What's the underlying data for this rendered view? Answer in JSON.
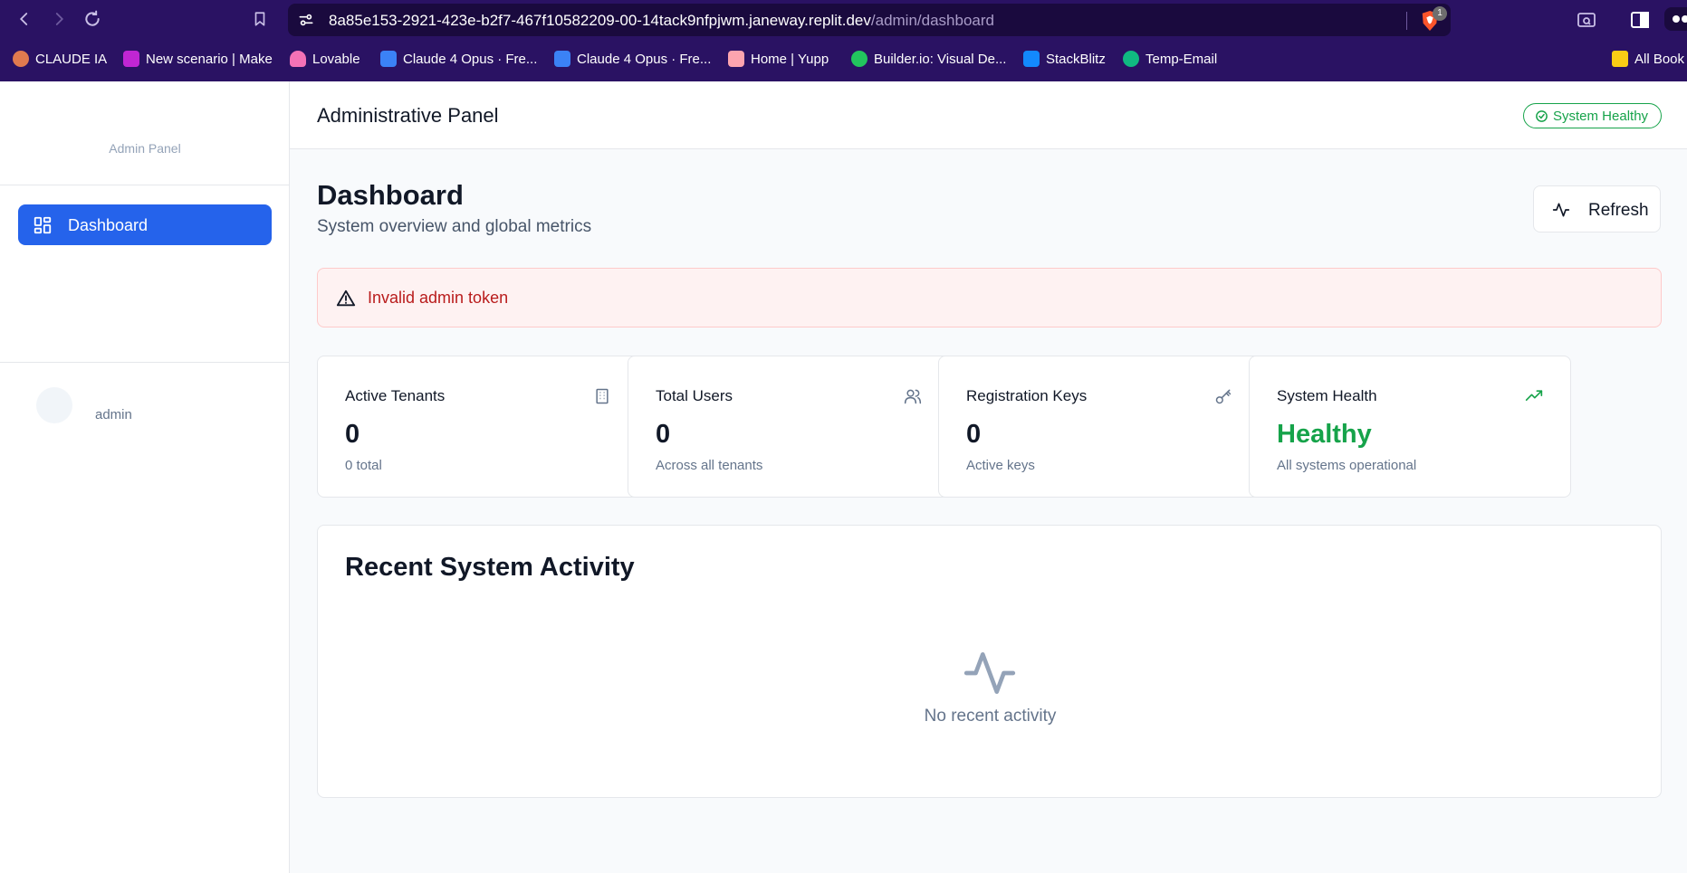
{
  "browser": {
    "url_main": "8a85e153-2921-423e-b2f7-467f10582209-00-14tack9nfpjwm.janeway.replit.dev",
    "url_path": "/admin/dashboard",
    "extension_badge": "1",
    "bookmarks": [
      {
        "label": "CLAUDE IA",
        "icon": "claude-icon",
        "color": "#e07a4f"
      },
      {
        "label": "New scenario | Make",
        "icon": "make-icon",
        "color": "#c026d3"
      },
      {
        "label": "Lovable",
        "icon": "lovable-icon",
        "color": "#f472b6"
      },
      {
        "label": "Claude 4 Opus · Fre...",
        "icon": "ai-icon",
        "color": "#3b82f6"
      },
      {
        "label": "Claude 4 Opus · Fre...",
        "icon": "ai-icon",
        "color": "#3b82f6"
      },
      {
        "label": "Home | Yupp",
        "icon": "yupp-icon",
        "color": "#fda4af"
      },
      {
        "label": "Builder.io: Visual De...",
        "icon": "builder-icon",
        "color": "#22c55e"
      },
      {
        "label": "StackBlitz",
        "icon": "stackblitz-icon",
        "color": "#1389fd"
      },
      {
        "label": "Temp-Email",
        "icon": "temp-email-icon",
        "color": "#10b981"
      },
      {
        "label": "All Book",
        "icon": "folder-icon",
        "color": "#facc15"
      }
    ]
  },
  "sidebar": {
    "title": "Admin Panel",
    "nav": [
      {
        "label": "Dashboard",
        "icon": "dashboard-grid-icon"
      }
    ],
    "user": "admin"
  },
  "header": {
    "title": "Administrative Panel",
    "status": "System Healthy"
  },
  "page": {
    "title": "Dashboard",
    "subtitle": "System overview and global metrics",
    "refresh_label": "Refresh",
    "alert": "Invalid admin token"
  },
  "cards": [
    {
      "title": "Active Tenants",
      "value": "0",
      "sub": "0 total",
      "icon": "building-icon"
    },
    {
      "title": "Total Users",
      "value": "0",
      "sub": "Across all tenants",
      "icon": "users-icon"
    },
    {
      "title": "Registration Keys",
      "value": "0",
      "sub": "Active keys",
      "icon": "key-icon"
    },
    {
      "title": "System Health",
      "value": "Healthy",
      "sub": "All systems operational",
      "icon": "trending-up-icon"
    }
  ],
  "activity": {
    "title": "Recent System Activity",
    "empty": "No recent activity"
  },
  "colors": {
    "chrome": "#2a1263",
    "primary": "#2563eb",
    "success": "#16a34a",
    "danger": "#b91c1c"
  }
}
